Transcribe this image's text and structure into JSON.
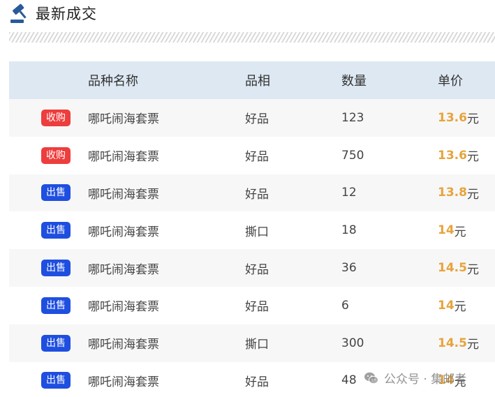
{
  "header": {
    "title": "最新成交",
    "icon": "gavel-icon"
  },
  "table": {
    "columns": [
      "",
      "品种名称",
      "品相",
      "数量",
      "单价"
    ],
    "rows": [
      {
        "badge": "收购",
        "badge_type": "buy",
        "name": "哪吒闹海套票",
        "condition": "好品",
        "quantity": "123",
        "price": "13.6",
        "unit": "元"
      },
      {
        "badge": "收购",
        "badge_type": "buy",
        "name": "哪吒闹海套票",
        "condition": "好品",
        "quantity": "750",
        "price": "13.6",
        "unit": "元"
      },
      {
        "badge": "出售",
        "badge_type": "sell",
        "name": "哪吒闹海套票",
        "condition": "好品",
        "quantity": "12",
        "price": "13.8",
        "unit": "元"
      },
      {
        "badge": "出售",
        "badge_type": "sell",
        "name": "哪吒闹海套票",
        "condition": "撕口",
        "quantity": "18",
        "price": "14",
        "unit": "元"
      },
      {
        "badge": "出售",
        "badge_type": "sell",
        "name": "哪吒闹海套票",
        "condition": "好品",
        "quantity": "36",
        "price": "14.5",
        "unit": "元"
      },
      {
        "badge": "出售",
        "badge_type": "sell",
        "name": "哪吒闹海套票",
        "condition": "好品",
        "quantity": "6",
        "price": "14",
        "unit": "元"
      },
      {
        "badge": "出售",
        "badge_type": "sell",
        "name": "哪吒闹海套票",
        "condition": "撕口",
        "quantity": "300",
        "price": "14.5",
        "unit": "元"
      },
      {
        "badge": "出售",
        "badge_type": "sell",
        "name": "哪吒闹海套票",
        "condition": "好品",
        "quantity": "48",
        "price": "14",
        "unit": "元"
      }
    ]
  },
  "watermark": {
    "text": "公众号 · 集邮者",
    "icon": "wechat-icon"
  },
  "colors": {
    "header_bg": "#dde8f3",
    "buy_badge": "#ee3d3d",
    "sell_badge": "#1f4fe0",
    "price": "#e7a33b",
    "row_alt": "#f7f7f7"
  }
}
